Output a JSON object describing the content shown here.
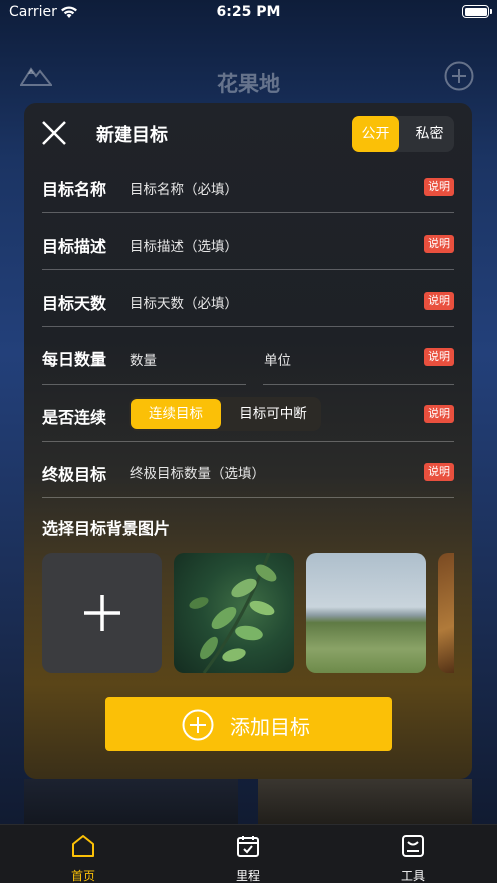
{
  "status_bar": {
    "carrier": "Carrier",
    "time": "6:25 PM"
  },
  "app": {
    "title": "花果地"
  },
  "modal": {
    "title": "新建目标",
    "visibility": {
      "public": "公开",
      "private": "私密",
      "selected": "公开"
    },
    "rows": [
      {
        "label": "目标名称",
        "placeholder": "目标名称（必填）",
        "help": "说明"
      },
      {
        "label": "目标描述",
        "placeholder": "目标描述（选填）",
        "help": "说明"
      },
      {
        "label": "目标天数",
        "placeholder": "目标天数（必填）",
        "help": "说明"
      },
      {
        "label": "每日数量",
        "quantity_placeholder": "数量",
        "unit_placeholder": "单位",
        "help": "说明"
      },
      {
        "label": "是否连续",
        "option_continuous": "连续目标",
        "option_interruptible": "目标可中断",
        "selected": "连续目标",
        "help": "说明"
      },
      {
        "label": "终极目标",
        "placeholder": "终极目标数量（选填）",
        "help": "说明"
      }
    ],
    "background_section_title": "选择目标背景图片",
    "submit_label": "添加目标"
  },
  "tabs": [
    {
      "label": "首页",
      "icon": "home-icon",
      "active": true
    },
    {
      "label": "里程",
      "icon": "calendar-check-icon",
      "active": false
    },
    {
      "label": "工具",
      "icon": "toolbox-icon",
      "active": false
    }
  ],
  "colors": {
    "accent": "#fbc007",
    "help_badge": "#e9503e",
    "modal_bg": "#202329",
    "tab_bar": "#1a1b1e"
  }
}
